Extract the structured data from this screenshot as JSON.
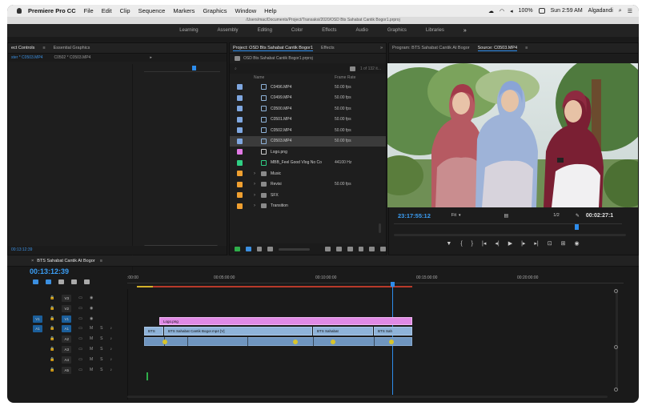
{
  "menubar": {
    "app_name": "Premiere Pro CC",
    "items": [
      "File",
      "Edit",
      "Clip",
      "Sequence",
      "Markers",
      "Graphics",
      "Window",
      "Help"
    ],
    "battery": "100%",
    "clock": "Sun 2:59 AM",
    "user": "Algadandi"
  },
  "path_bar": "/Users/mac/Documents/Project/Transaksi/2020/OSD Bts Sahabat Cantik Bogor1.prproj",
  "workspaces": [
    "Learning",
    "Assembly",
    "Editing",
    "Color",
    "Effects",
    "Audio",
    "Graphics",
    "Libraries"
  ],
  "workspaces_more": "»",
  "effect_controls": {
    "tabs": [
      "ect Controls",
      "Essential Graphics"
    ],
    "sub_master": "ster * C0503.MP4",
    "sub_clip": "C0502 * C0503.MP4",
    "bottom_tc": "00:13:12:39"
  },
  "project": {
    "tabs": [
      "Project: OSD Bts Sahabat Cantik Bogor1",
      "Effects"
    ],
    "more": "»",
    "path_label": "OSD Bts Sahabat Cantik Bogor1.prproj",
    "count": "1 of 132 it...",
    "col_name": "Name",
    "col_fps": "Frame Rate",
    "rows": [
      {
        "name": "C0496.MP4",
        "fps": "50.00 fps",
        "color": "#7fa7e0",
        "kind": "clip"
      },
      {
        "name": "C0499.MP4",
        "fps": "50.00 fps",
        "color": "#7fa7e0",
        "kind": "clip"
      },
      {
        "name": "C0500.MP4",
        "fps": "50.00 fps",
        "color": "#7fa7e0",
        "kind": "clip"
      },
      {
        "name": "C0501.MP4",
        "fps": "50.00 fps",
        "color": "#7fa7e0",
        "kind": "clip"
      },
      {
        "name": "C0502.MP4",
        "fps": "50.00 fps",
        "color": "#7fa7e0",
        "kind": "clip"
      },
      {
        "name": "C0503.MP4",
        "fps": "50.00 fps",
        "color": "#7fa7e0",
        "kind": "clip",
        "selected": true
      },
      {
        "name": "Logo.png",
        "fps": "",
        "color": "#e27ae5",
        "kind": "image"
      },
      {
        "name": "MBB_Feel Good Vlog No Co",
        "fps": "44100 Hz",
        "color": "#2fcf84",
        "kind": "sequence"
      },
      {
        "name": "Music",
        "fps": "",
        "color": "#f0a030",
        "kind": "folder"
      },
      {
        "name": "Revisi",
        "fps": "50.00 fps",
        "color": "#f0a030",
        "kind": "folder"
      },
      {
        "name": "SFX",
        "fps": "",
        "color": "#f0a030",
        "kind": "folder"
      },
      {
        "name": "Transition",
        "fps": "",
        "color": "#f0a030",
        "kind": "folder"
      }
    ]
  },
  "monitor": {
    "tabs": [
      "Program: BTS Sahabat Cantik At Bogor",
      "Source: C0503.MP4"
    ],
    "timecode_left": "23:17:55:12",
    "fit": "Fit",
    "resolution": "1/2",
    "timecode_right": "00:02:27:1",
    "transport": [
      "marker-icon",
      "in-point-icon",
      "out-point-icon",
      "go-to-in-icon",
      "step-back-icon",
      "play-icon",
      "step-forward-icon",
      "go-to-out-icon",
      "insert-icon",
      "overwrite-icon",
      "export-frame-icon"
    ]
  },
  "timeline": {
    "tab": "BTS Sahabat Cantik At Bogor",
    "timecode": "00:13:12:39",
    "ruler": [
      ":00:00",
      "00:05:00:00",
      "00:10:00:00",
      "00:15:00:00",
      "00:20:00:00"
    ],
    "video_tracks": [
      "V3",
      "V2",
      "V1"
    ],
    "audio_tracks": [
      "A1",
      "A2",
      "A3",
      "A4",
      "A5"
    ],
    "source_v": "V1",
    "source_a": "A1",
    "track_flags": [
      "M",
      "S"
    ],
    "clips": {
      "logo": "Logo.png",
      "v1": [
        "BTS",
        "BTS Sahabat Cantik Bogor.mp4 [V]",
        "BTS Sahabat",
        "BTS Sah"
      ]
    }
  },
  "colors": {
    "accent_blue": "#2d8ceb",
    "clip_video": "#8fb3d9",
    "clip_pink": "#e08ae5",
    "work_area": "#b83a2a"
  }
}
